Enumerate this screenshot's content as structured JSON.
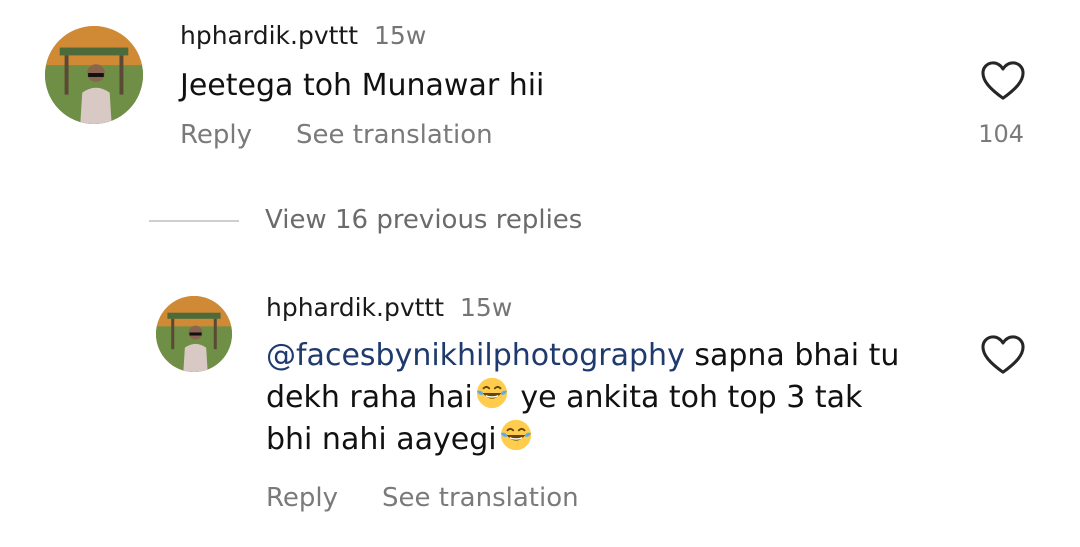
{
  "comments": [
    {
      "username": "hphardik.pvttt",
      "time": "15w",
      "text": "Jeetega toh Munawar hii",
      "reply_label": "Reply",
      "translate_label": "See translation",
      "like_count": "104",
      "icons": {
        "like": "heart-outline-icon"
      }
    },
    {
      "username": "hphardik.pvttt",
      "time": "15w",
      "mention": "@facesbynikhilphotography",
      "line1_rest": " sapna bhai tu",
      "line2a": "dekh raha hai",
      "line2b": " ye ankita toh top 3 tak",
      "line3": "bhi nahi aayegi",
      "emoji": "face-with-tears-of-joy",
      "reply_label": "Reply",
      "translate_label": "See translation",
      "icons": {
        "like": "heart-outline-icon"
      }
    }
  ],
  "view_replies_label": "View 16 previous replies",
  "colors": {
    "mention": "#1f3a6e",
    "secondary_text": "#7a7a7a",
    "primary_text": "#111111"
  }
}
